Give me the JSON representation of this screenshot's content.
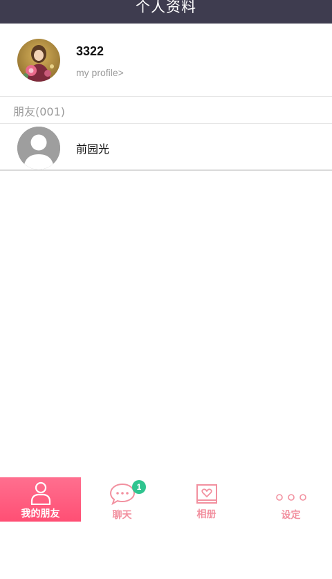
{
  "header": {
    "title": "个人资料"
  },
  "profile": {
    "name": "3322",
    "link_label": "my profile>"
  },
  "friends_section": {
    "label": "朋友(001)",
    "items": [
      {
        "name": "前园光"
      }
    ]
  },
  "tabbar": {
    "tabs": [
      {
        "label": "我的朋友",
        "icon": "person-icon",
        "active": true
      },
      {
        "label": "聊天",
        "icon": "chat-bubble-icon",
        "badge": "1"
      },
      {
        "label": "相册",
        "icon": "photo-album-icon"
      },
      {
        "label": "设定",
        "icon": "more-dots-icon"
      }
    ]
  },
  "colors": {
    "header_bg": "#3e3c4f",
    "accent_pink": "#ff5a7d",
    "tab_label_pink": "#f2909f",
    "badge_green": "#2fc48f"
  }
}
